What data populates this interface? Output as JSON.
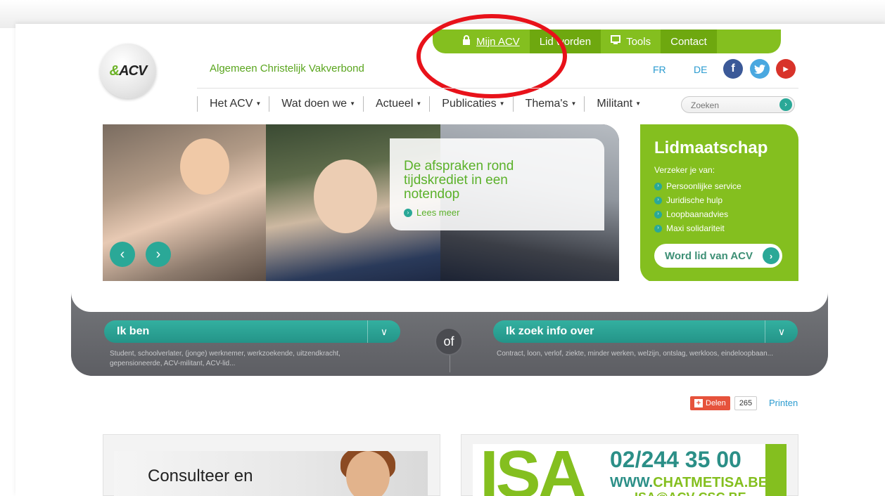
{
  "top_tabs": [
    {
      "icon": "lock-icon",
      "label": "Mijn ACV"
    },
    {
      "label": "Lid worden"
    },
    {
      "icon": "tools-icon",
      "label": "Tools"
    },
    {
      "label": "Contact"
    }
  ],
  "header": {
    "tagline": "Algemeen Christelijk Vakverbond",
    "logo_text": "ACV",
    "languages": [
      "FR",
      "DE"
    ]
  },
  "nav": {
    "items": [
      "Het ACV",
      "Wat doen we",
      "Actueel",
      "Publicaties",
      "Thema's",
      "Militant"
    ],
    "search_placeholder": "Zoeken"
  },
  "hero": {
    "title": "De afspraken rond tijdskrediet in een notendop",
    "link": "Lees meer"
  },
  "membership": {
    "title": "Lidmaatschap",
    "intro": "Verzeker je van:",
    "benefits": [
      "Persoonlijke service",
      "Juridische hulp",
      "Loopbaanadvies",
      "Maxi solidariteit"
    ],
    "button": "Word lid van ACV"
  },
  "finder": {
    "left_label": "Ik ben",
    "left_desc": "Student, schoolverlater, (jonge) werknemer, werkzoekende, uitzendkracht, gepensioneerde, ACV-militant, ACV-lid...",
    "or": "of",
    "right_label": "Ik zoek info over",
    "right_desc": "Contract, loon, verlof, ziekte, minder werken, welzijn, ontslag, werkloos, eindeloopbaan..."
  },
  "share": {
    "label": "Delen",
    "count": "265",
    "print": "Printen"
  },
  "promos": {
    "consult": "Consulteer en",
    "isa_big": "ISA",
    "isa_phone": "02/244 35 00",
    "isa_www_prefix": "WWW.",
    "isa_www_domain": "CHATMETISA.BE",
    "isa_mail": "ISA@ACV-CSC.BE"
  },
  "colors": {
    "green": "#84bf1f",
    "teal": "#2aa897",
    "highlight": "#e8121a"
  }
}
